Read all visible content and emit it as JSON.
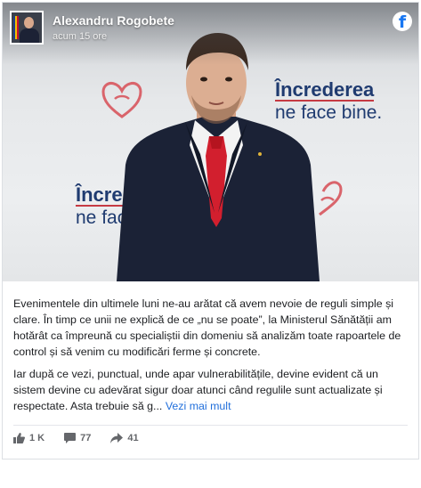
{
  "post": {
    "author": "Alexandru Rogobete",
    "time": "acum 15 ore",
    "platform_icon": "facebook-icon",
    "photo": {
      "slogan_line1": "Încrederea",
      "slogan_line2": "ne face bine.",
      "slogan2_line1": "Încrede",
      "slogan2_line2": "ne face"
    },
    "paragraph1": "Evenimentele din ultimele luni ne-au arătat că avem nevoie de reguli simple și clare. În timp ce unii ne explică de ce „nu se poate”, la Ministerul Sănătății am hotărât ca împreună cu specialiștii din domeniu să analizăm toate rapoartele de control și să venim cu modificări ferme și concrete.",
    "paragraph2": "Iar după ce vezi, punctual, unde apar vulnerabilitățile, devine evident că un sistem devine cu adevărat sigur doar atunci când regulile sunt actualizate și respectate. Asta trebuie să g...",
    "see_more": "Vezi mai mult"
  },
  "stats": {
    "likes": "1 K",
    "comments": "77",
    "shares": "41"
  },
  "colors": {
    "brand_navy": "#1f3b70",
    "brand_red": "#c63a43",
    "link_blue": "#216fdb",
    "facebook_blue": "#1877f2"
  }
}
